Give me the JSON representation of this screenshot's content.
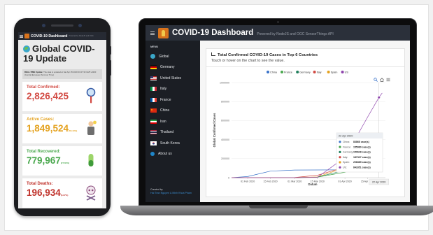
{
  "mobile": {
    "app_title": "COVID-19 Dashboard",
    "app_subtitle": "Powered by NodeJS and OGC",
    "heading": "Global COVID-19 Update",
    "realtime_label": "REAL-TIME Update:",
    "realtime_text": "The data is updated at Sat Apr 25 2020 03:27:33 GMT+0200 (Central European Summer Time)",
    "cards": [
      {
        "label": "Total Confirmed:",
        "value": "2,826,425",
        "pct": "",
        "color": "#d24a43",
        "icon": "magnifier-icon"
      },
      {
        "label": "Active Cases:",
        "value": "1,849,524",
        "pct": "(65.44%)",
        "color": "#e4a21f",
        "icon": "patient-icon"
      },
      {
        "label": "Total Recovered:",
        "value": "779,967",
        "pct": "(27.60%)",
        "color": "#4aa84e",
        "icon": "pill-icon"
      },
      {
        "label": "Total Deaths:",
        "value": "196,934",
        "pct": "(6.97%)",
        "color": "#c0332c",
        "icon": "skull-icon"
      }
    ]
  },
  "desktop": {
    "app_title": "COVID-19 Dashboard",
    "app_subtitle": "Powered by NodeJS and OGC SensorThings API",
    "menu_label": "MENU",
    "sidebar": [
      {
        "label": "Global",
        "icon": "globe-icon"
      },
      {
        "label": "Germany",
        "icon": "flag-germany-icon"
      },
      {
        "label": "United States",
        "icon": "flag-usa-icon"
      },
      {
        "label": "Italy",
        "icon": "flag-italy-icon"
      },
      {
        "label": "France",
        "icon": "flag-france-icon"
      },
      {
        "label": "China",
        "icon": "flag-china-icon"
      },
      {
        "label": "Iran",
        "icon": "flag-iran-icon"
      },
      {
        "label": "Thailand",
        "icon": "flag-thailand-icon"
      },
      {
        "label": "South Korea",
        "icon": "flag-south-korea-icon"
      },
      {
        "label": "About us",
        "icon": "info-icon"
      }
    ],
    "created_by_label": "Created by",
    "created_by_names": "Hai Tran Nguyen & Minh Khoa Pham",
    "panel_title": "Total Confirmed COVID-19 Cases in Top 6 Countries",
    "panel_subtitle": "Touch or hover on the chart to see the value.",
    "tooltip_title": "22 Apr 2020",
    "x_hover_label": "22 Apr 2020"
  },
  "chart_data": {
    "type": "line",
    "ylabel": "Global Confirmed Cases",
    "xlabel": "Datum",
    "ylim": [
      0,
      1000000
    ],
    "yticks": [
      0,
      200000,
      400000,
      600000,
      800000,
      1000000
    ],
    "ytick_labels": [
      "0",
      "200000",
      "400000",
      "600000",
      "800000",
      "1000000"
    ],
    "x_ticks": [
      "01 Feb 2020",
      "15 Feb 2020",
      "01 Mar 2020",
      "15 Mar 2020",
      "01 Apr 2020",
      "15 Apr 2020"
    ],
    "x": [
      "22 Jan 2020",
      "01 Feb 2020",
      "15 Feb 2020",
      "01 Mar 2020",
      "15 Mar 2020",
      "01 Apr 2020",
      "15 Apr 2020",
      "22 Apr 2020",
      "24 Apr 2020"
    ],
    "series": [
      {
        "name": "China",
        "color": "#3a73c9",
        "values": [
          550,
          11900,
          68500,
          79900,
          81000,
          82300,
          83350,
          83868,
          83900
        ]
      },
      {
        "name": "France",
        "color": "#4aa84e",
        "values": [
          0,
          6,
          12,
          130,
          5400,
          57000,
          148000,
          155980,
          161000
        ]
      },
      {
        "name": "Germany",
        "color": "#1f7f5c",
        "values": [
          0,
          8,
          16,
          130,
          5800,
          77900,
          134700,
          150648,
          154000
        ]
      },
      {
        "name": "Italy",
        "color": "#d24a43",
        "values": [
          0,
          2,
          3,
          1700,
          24700,
          110600,
          165100,
          187327,
          192000
        ]
      },
      {
        "name": "Spain",
        "color": "#e4a21f",
        "values": [
          0,
          1,
          2,
          84,
          7800,
          104100,
          177600,
          208389,
          219000
        ]
      },
      {
        "name": "US",
        "color": "#8e44ad",
        "values": [
          1,
          8,
          15,
          30,
          3500,
          213000,
          637000,
          843351,
          890000
        ]
      }
    ],
    "tooltip": [
      {
        "country": "China",
        "value": "83868 case(s)"
      },
      {
        "country": "France",
        "value": "155980 case(s)"
      },
      {
        "country": "Germany",
        "value": "150648 case(s)"
      },
      {
        "country": "Italy",
        "value": "187327 case(s)"
      },
      {
        "country": "Spain",
        "value": "208389 case(s)"
      },
      {
        "country": "US",
        "value": "843351 case(s)"
      }
    ],
    "legend_position": "top",
    "grid": true
  }
}
